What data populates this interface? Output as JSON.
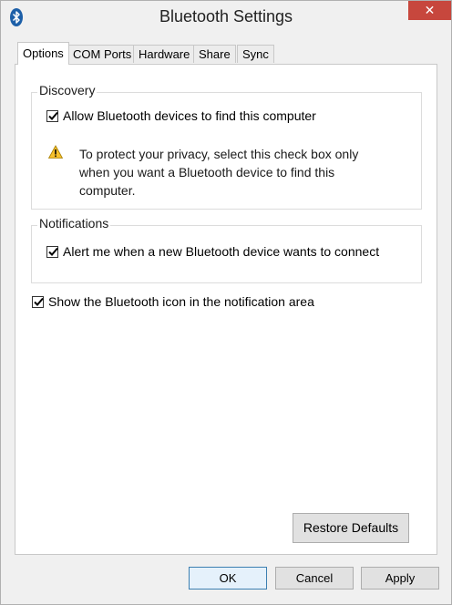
{
  "window": {
    "title": "Bluetooth Settings",
    "close_glyph": "✕",
    "accent_close": "#c7473d"
  },
  "tabs": [
    {
      "label": "Options",
      "active": true
    },
    {
      "label": "COM Ports"
    },
    {
      "label": "Hardware"
    },
    {
      "label": "Share"
    },
    {
      "label": "Sync"
    }
  ],
  "discovery": {
    "label": "Discovery",
    "allow_label": "Allow Bluetooth devices to find this computer",
    "allow_checked": true,
    "warning_line1": "To protect your privacy, select this check box only",
    "warning_line2": "when you want a Bluetooth device to find this",
    "warning_line3": "computer."
  },
  "notifications": {
    "label": "Notifications",
    "alert_label": "Alert me when a new Bluetooth device wants to connect",
    "alert_checked": true
  },
  "show_icon": {
    "label": "Show the Bluetooth icon in the notification area",
    "checked": true
  },
  "buttons": {
    "restore_defaults": "Restore Defaults",
    "ok": "OK",
    "cancel": "Cancel",
    "apply": "Apply"
  },
  "icons": {
    "app": "bluetooth-icon",
    "warning": "warning-icon"
  }
}
